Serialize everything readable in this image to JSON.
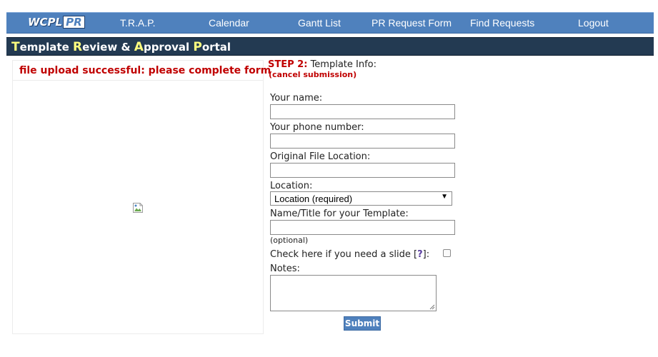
{
  "nav": {
    "logo": {
      "part1": "WCPL",
      "part2": "PR"
    },
    "links": [
      "T.R.A.P.",
      "Calendar",
      "Gantt List",
      "PR Request Form",
      "Find Requests",
      "Logout"
    ]
  },
  "title": {
    "w1_cap": "T",
    "w1_rest": "emplate",
    "w2_cap": "R",
    "w2_rest": "eview",
    "amp": "&",
    "w3_cap": "A",
    "w3_rest": "pproval",
    "w4_cap": "P",
    "w4_rest": "ortal"
  },
  "upload_message": "file upload successful: please complete form",
  "form": {
    "step_label": "STEP 2:",
    "step_title": "Template Info:",
    "cancel_link": "(cancel submission)",
    "name_label": "Your name:",
    "name_value": "",
    "phone_label": "Your phone number:",
    "phone_value": "",
    "file_location_label": "Original File Location:",
    "file_location_value": "",
    "location_label": "Location:",
    "location_selected": "Location (required)",
    "template_title_label": "Name/Title for your Template:",
    "template_title_value": "",
    "optional_note": "(optional)",
    "slide_label": "Check here if you need a slide",
    "slide_help_open": "[",
    "slide_help_mark": "?",
    "slide_help_close": "]:",
    "slide_checked": false,
    "notes_label": "Notes:",
    "notes_value": "",
    "submit_label": "Submit"
  },
  "colors": {
    "nav_bg": "#4f81bd",
    "title_bg": "#233a52",
    "title_accent": "#ffff7f",
    "alert_red": "#c00000"
  }
}
